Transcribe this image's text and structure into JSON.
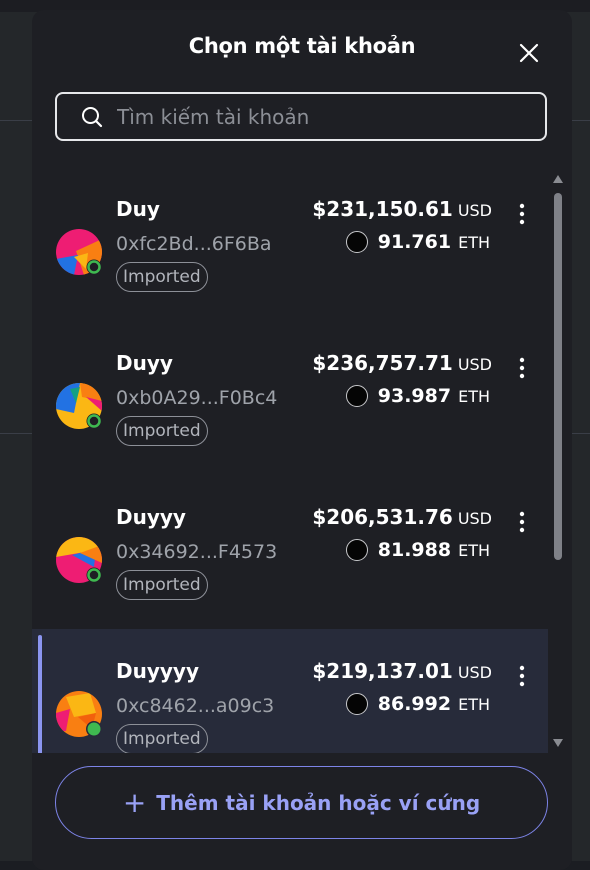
{
  "modal": {
    "title": "Chọn một tài khoản",
    "search_placeholder": "Tìm kiếm tài khoản"
  },
  "accounts": [
    {
      "name": "Duy",
      "address": "0xfc2Bd...6F6Ba",
      "badge": "Imported",
      "fiat": "$231,150.61",
      "fiat_unit": "USD",
      "crypto": "91.761",
      "crypto_unit": "ETH",
      "selected": false
    },
    {
      "name": "Duyy",
      "address": "0xb0A29...F0Bc4",
      "badge": "Imported",
      "fiat": "$236,757.71",
      "fiat_unit": "USD",
      "crypto": "93.987",
      "crypto_unit": "ETH",
      "selected": false
    },
    {
      "name": "Duyyy",
      "address": "0x34692...F4573",
      "badge": "Imported",
      "fiat": "$206,531.76",
      "fiat_unit": "USD",
      "crypto": "81.988",
      "crypto_unit": "ETH",
      "selected": false
    },
    {
      "name": "Duyyyy",
      "address": "0xc8462...a09c3",
      "badge": "Imported",
      "fiat": "$219,137.01",
      "fiat_unit": "USD",
      "crypto": "86.992",
      "crypto_unit": "ETH",
      "selected": true
    }
  ],
  "footer": {
    "add_label": "Thêm tài khoản hoặc ví cứng",
    "plus_symbol": "+"
  },
  "colors": {
    "accent": "#7d84e8",
    "selected_bg": "#272b3a",
    "status_green": "#3fb950"
  }
}
